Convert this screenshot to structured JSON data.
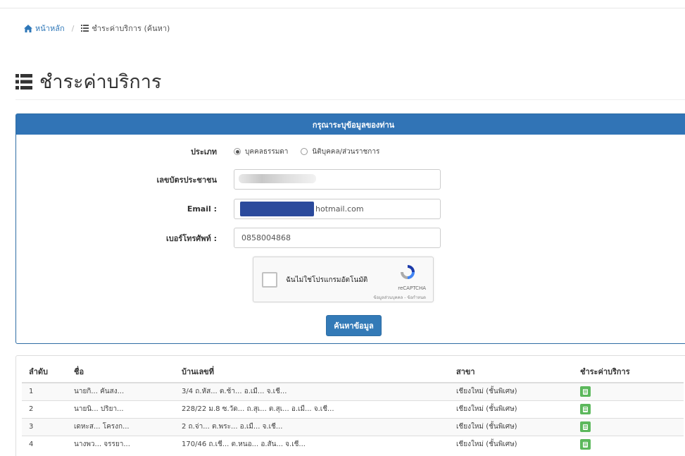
{
  "breadcrumb": {
    "home_label": "หน้าหลัก",
    "current_label": "ชำระค่าบริการ (ค้นหา)"
  },
  "page": {
    "title": "ชำระค่าบริการ"
  },
  "form": {
    "panel_title": "กรุณาระบุข้อมูลของท่าน",
    "type_label": "ประเภท",
    "type_options": [
      "บุคคลธรรมดา",
      "นิติบุคคล/ส่วนราชการ"
    ],
    "type_selected": "บุคคลธรรมดา",
    "id_label": "เลขบัตรประชาชน",
    "id_value": "",
    "email_label": "Email :",
    "email_value": "hotmail.com",
    "phone_label": "เบอร์โทรศัพท์ :",
    "phone_value": "0858004868",
    "captcha_text": "ฉันไม่ใช่โปรแกรมอัตโนมัติ",
    "captcha_brand": "reCAPTCHA",
    "captcha_terms": "ข้อมูลส่วนบุคคล - ข้อกำหนด",
    "search_button": "ค้นหาข้อมูล"
  },
  "results": {
    "columns": [
      "ลำดับ",
      "ชื่อ",
      "บ้านเลขที่",
      "สาขา",
      "ชำระค่าบริการ"
    ],
    "rows": [
      [
        "1",
        "นายกิ... คันสง...",
        "3/4 ถ.หัส... ต.ช้า... อ.เมื... จ.เชี...",
        "เชียงใหม่ (ชั้นพิเศษ)"
      ],
      [
        "2",
        "นายนิ... ปริยา...",
        "228/22 ม.8 ซ.วัด... ถ.สุเ... ต.สุเ... อ.เมื... จ.เชี...",
        "เชียงใหม่ (ชั้นพิเศษ)"
      ],
      [
        "3",
        "เดหะส... โครงก...",
        "2 ถ.จ่า... ต.พระ... อ.เมื... จ.เชี...",
        "เชียงใหม่ (ชั้นพิเศษ)"
      ],
      [
        "4",
        "นางพว... จรรยา...",
        "170/46 ถ.เชี... ต.หนอ... อ.สัน... จ.เชี...",
        "เชียงใหม่ (ชั้นพิเศษ)"
      ]
    ]
  },
  "colors": {
    "primary": "#337ab7",
    "panel_header": "#3174b6",
    "pay_button": "#5cb85c"
  }
}
